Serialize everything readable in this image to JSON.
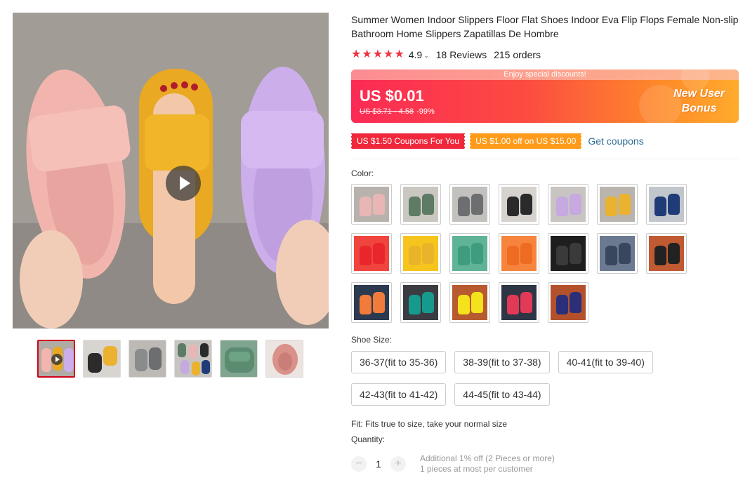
{
  "product": {
    "title": "Summer Women Indoor Slippers Floor Flat Shoes Indoor Eva Flip Flops Female Non-slip Bathroom Home Slippers Zapatillas De Hombre",
    "rating": "4.9",
    "reviews": "18 Reviews",
    "orders": "215 orders",
    "star_icon": "star-icon",
    "star_color": "#ed3445"
  },
  "gallery": {
    "main_image": "pink-yellow-purple-slippers-photo",
    "play_icon": "play-icon",
    "thumbnails": [
      {
        "name": "thumb-video",
        "active": true
      },
      {
        "name": "thumb-black-yellow"
      },
      {
        "name": "thumb-gray"
      },
      {
        "name": "thumb-multicolor"
      },
      {
        "name": "thumb-green"
      },
      {
        "name": "thumb-pink"
      }
    ]
  },
  "banner": {
    "top_text": "Enjoy special discounts!",
    "price": "US $0.01",
    "original_price": "US $3.71 - 4.58",
    "discount": "-99%",
    "new_user_line1": "New User",
    "new_user_line2": "Bonus"
  },
  "coupons": {
    "coupon1": "US $1.50 Coupons For You",
    "coupon2": "US $1.00 off on US $15.00",
    "get_coupons": "Get coupons"
  },
  "color": {
    "label": "Color:",
    "swatches": [
      {
        "name": "pink",
        "bg": "#b8b2ad",
        "shoe": "#e8b6b4"
      },
      {
        "name": "green",
        "bg": "#c9c7c0",
        "shoe": "#5e7b66"
      },
      {
        "name": "gray",
        "bg": "#c3c1bd",
        "shoe": "#6d6e70"
      },
      {
        "name": "black",
        "bg": "#d6d3cf",
        "shoe": "#2a2a2a"
      },
      {
        "name": "purple",
        "bg": "#c8c4c2",
        "shoe": "#c6a9e0"
      },
      {
        "name": "yellow",
        "bg": "#b9b4ad",
        "shoe": "#eab22e"
      },
      {
        "name": "navy",
        "bg": "#c1c6cc",
        "shoe": "#1f3b78"
      },
      {
        "name": "red",
        "bg": "#f0453e",
        "shoe": "#e8262c"
      },
      {
        "name": "mustard",
        "bg": "#f5c51e",
        "shoe": "#eab42a"
      },
      {
        "name": "teal",
        "bg": "#5fb397",
        "shoe": "#3f9c7e"
      },
      {
        "name": "orange",
        "bg": "#f6843c",
        "shoe": "#ee6b22"
      },
      {
        "name": "dark-black",
        "bg": "#1e1e1e",
        "shoe": "#3a3a3a"
      },
      {
        "name": "slate",
        "bg": "#6b7a91",
        "shoe": "#38465e"
      },
      {
        "name": "black-round",
        "bg": "#c05a32",
        "shoe": "#222222"
      },
      {
        "name": "orange-round",
        "bg": "#2c3a50",
        "shoe": "#f07b3b"
      },
      {
        "name": "teal-round",
        "bg": "#3a3c42",
        "shoe": "#169a8e"
      },
      {
        "name": "yellow-round",
        "bg": "#b75a30",
        "shoe": "#f3e21c"
      },
      {
        "name": "red-round",
        "bg": "#2e3646",
        "shoe": "#e23956"
      },
      {
        "name": "navy-round",
        "bg": "#b3512c",
        "shoe": "#2b2f7a"
      }
    ]
  },
  "size": {
    "label": "Shoe Size:",
    "options": [
      "36-37(fit to 35-36)",
      "38-39(fit to 37-38)",
      "40-41(fit to 39-40)",
      "42-43(fit to 41-42)",
      "44-45(fit to 43-44)"
    ]
  },
  "fit": "Fit: Fits true to size, take your normal size",
  "quantity": {
    "label": "Quantity:",
    "value": "1",
    "minus": "−",
    "plus": "+",
    "note1": "Additional 1% off (2 Pieces or more)",
    "note2": "1 pieces at most per customer"
  }
}
